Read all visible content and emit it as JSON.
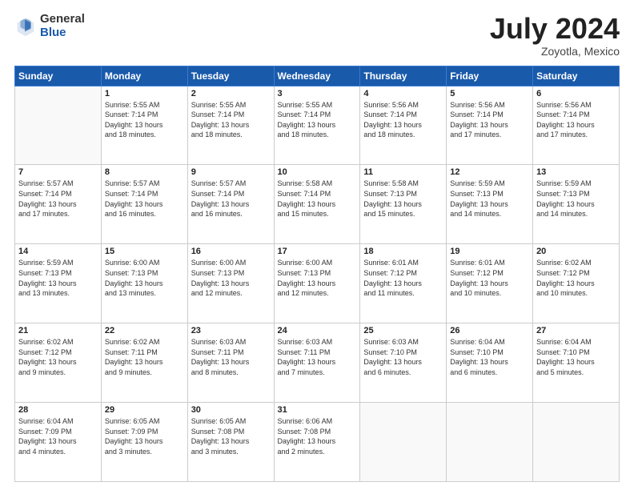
{
  "header": {
    "logo_general": "General",
    "logo_blue": "Blue",
    "month_year": "July 2024",
    "location": "Zoyotla, Mexico"
  },
  "weekdays": [
    "Sunday",
    "Monday",
    "Tuesday",
    "Wednesday",
    "Thursday",
    "Friday",
    "Saturday"
  ],
  "weeks": [
    [
      {
        "day": "",
        "info": ""
      },
      {
        "day": "1",
        "info": "Sunrise: 5:55 AM\nSunset: 7:14 PM\nDaylight: 13 hours\nand 18 minutes."
      },
      {
        "day": "2",
        "info": "Sunrise: 5:55 AM\nSunset: 7:14 PM\nDaylight: 13 hours\nand 18 minutes."
      },
      {
        "day": "3",
        "info": "Sunrise: 5:55 AM\nSunset: 7:14 PM\nDaylight: 13 hours\nand 18 minutes."
      },
      {
        "day": "4",
        "info": "Sunrise: 5:56 AM\nSunset: 7:14 PM\nDaylight: 13 hours\nand 18 minutes."
      },
      {
        "day": "5",
        "info": "Sunrise: 5:56 AM\nSunset: 7:14 PM\nDaylight: 13 hours\nand 17 minutes."
      },
      {
        "day": "6",
        "info": "Sunrise: 5:56 AM\nSunset: 7:14 PM\nDaylight: 13 hours\nand 17 minutes."
      }
    ],
    [
      {
        "day": "7",
        "info": "Sunrise: 5:57 AM\nSunset: 7:14 PM\nDaylight: 13 hours\nand 17 minutes."
      },
      {
        "day": "8",
        "info": "Sunrise: 5:57 AM\nSunset: 7:14 PM\nDaylight: 13 hours\nand 16 minutes."
      },
      {
        "day": "9",
        "info": "Sunrise: 5:57 AM\nSunset: 7:14 PM\nDaylight: 13 hours\nand 16 minutes."
      },
      {
        "day": "10",
        "info": "Sunrise: 5:58 AM\nSunset: 7:14 PM\nDaylight: 13 hours\nand 15 minutes."
      },
      {
        "day": "11",
        "info": "Sunrise: 5:58 AM\nSunset: 7:13 PM\nDaylight: 13 hours\nand 15 minutes."
      },
      {
        "day": "12",
        "info": "Sunrise: 5:59 AM\nSunset: 7:13 PM\nDaylight: 13 hours\nand 14 minutes."
      },
      {
        "day": "13",
        "info": "Sunrise: 5:59 AM\nSunset: 7:13 PM\nDaylight: 13 hours\nand 14 minutes."
      }
    ],
    [
      {
        "day": "14",
        "info": "Sunrise: 5:59 AM\nSunset: 7:13 PM\nDaylight: 13 hours\nand 13 minutes."
      },
      {
        "day": "15",
        "info": "Sunrise: 6:00 AM\nSunset: 7:13 PM\nDaylight: 13 hours\nand 13 minutes."
      },
      {
        "day": "16",
        "info": "Sunrise: 6:00 AM\nSunset: 7:13 PM\nDaylight: 13 hours\nand 12 minutes."
      },
      {
        "day": "17",
        "info": "Sunrise: 6:00 AM\nSunset: 7:13 PM\nDaylight: 13 hours\nand 12 minutes."
      },
      {
        "day": "18",
        "info": "Sunrise: 6:01 AM\nSunset: 7:12 PM\nDaylight: 13 hours\nand 11 minutes."
      },
      {
        "day": "19",
        "info": "Sunrise: 6:01 AM\nSunset: 7:12 PM\nDaylight: 13 hours\nand 10 minutes."
      },
      {
        "day": "20",
        "info": "Sunrise: 6:02 AM\nSunset: 7:12 PM\nDaylight: 13 hours\nand 10 minutes."
      }
    ],
    [
      {
        "day": "21",
        "info": "Sunrise: 6:02 AM\nSunset: 7:12 PM\nDaylight: 13 hours\nand 9 minutes."
      },
      {
        "day": "22",
        "info": "Sunrise: 6:02 AM\nSunset: 7:11 PM\nDaylight: 13 hours\nand 9 minutes."
      },
      {
        "day": "23",
        "info": "Sunrise: 6:03 AM\nSunset: 7:11 PM\nDaylight: 13 hours\nand 8 minutes."
      },
      {
        "day": "24",
        "info": "Sunrise: 6:03 AM\nSunset: 7:11 PM\nDaylight: 13 hours\nand 7 minutes."
      },
      {
        "day": "25",
        "info": "Sunrise: 6:03 AM\nSunset: 7:10 PM\nDaylight: 13 hours\nand 6 minutes."
      },
      {
        "day": "26",
        "info": "Sunrise: 6:04 AM\nSunset: 7:10 PM\nDaylight: 13 hours\nand 6 minutes."
      },
      {
        "day": "27",
        "info": "Sunrise: 6:04 AM\nSunset: 7:10 PM\nDaylight: 13 hours\nand 5 minutes."
      }
    ],
    [
      {
        "day": "28",
        "info": "Sunrise: 6:04 AM\nSunset: 7:09 PM\nDaylight: 13 hours\nand 4 minutes."
      },
      {
        "day": "29",
        "info": "Sunrise: 6:05 AM\nSunset: 7:09 PM\nDaylight: 13 hours\nand 3 minutes."
      },
      {
        "day": "30",
        "info": "Sunrise: 6:05 AM\nSunset: 7:08 PM\nDaylight: 13 hours\nand 3 minutes."
      },
      {
        "day": "31",
        "info": "Sunrise: 6:06 AM\nSunset: 7:08 PM\nDaylight: 13 hours\nand 2 minutes."
      },
      {
        "day": "",
        "info": ""
      },
      {
        "day": "",
        "info": ""
      },
      {
        "day": "",
        "info": ""
      }
    ]
  ]
}
